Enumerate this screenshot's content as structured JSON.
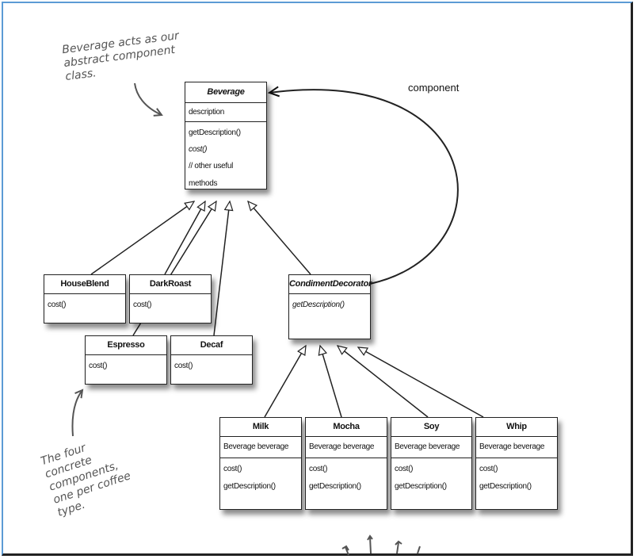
{
  "notes": {
    "beverage_note": "Beverage acts as our abstract component class.",
    "concrete_note": "The four concrete components, one per coffee type."
  },
  "association_label": "component",
  "beverage": {
    "name": "Beverage",
    "fields": [
      "description"
    ],
    "methods": [
      "getDescription()",
      "cost()",
      "// other useful methods"
    ]
  },
  "concrete": [
    {
      "name": "HouseBlend",
      "methods": [
        "cost()"
      ]
    },
    {
      "name": "DarkRoast",
      "methods": [
        "cost()"
      ]
    },
    {
      "name": "Espresso",
      "methods": [
        "cost()"
      ]
    },
    {
      "name": "Decaf",
      "methods": [
        "cost()"
      ]
    }
  ],
  "decorator": {
    "name": "CondimentDecorator",
    "methods": [
      "getDescription()"
    ]
  },
  "condiments": [
    {
      "name": "Milk",
      "field": "Beverage beverage",
      "methods": [
        "cost()",
        "getDescription()"
      ]
    },
    {
      "name": "Mocha",
      "field": "Beverage beverage",
      "methods": [
        "cost()",
        "getDescription()"
      ]
    },
    {
      "name": "Soy",
      "field": "Beverage beverage",
      "methods": [
        "cost()",
        "getDescription()"
      ]
    },
    {
      "name": "Whip",
      "field": "Beverage beverage",
      "methods": [
        "cost()",
        "getDescription()"
      ]
    }
  ]
}
